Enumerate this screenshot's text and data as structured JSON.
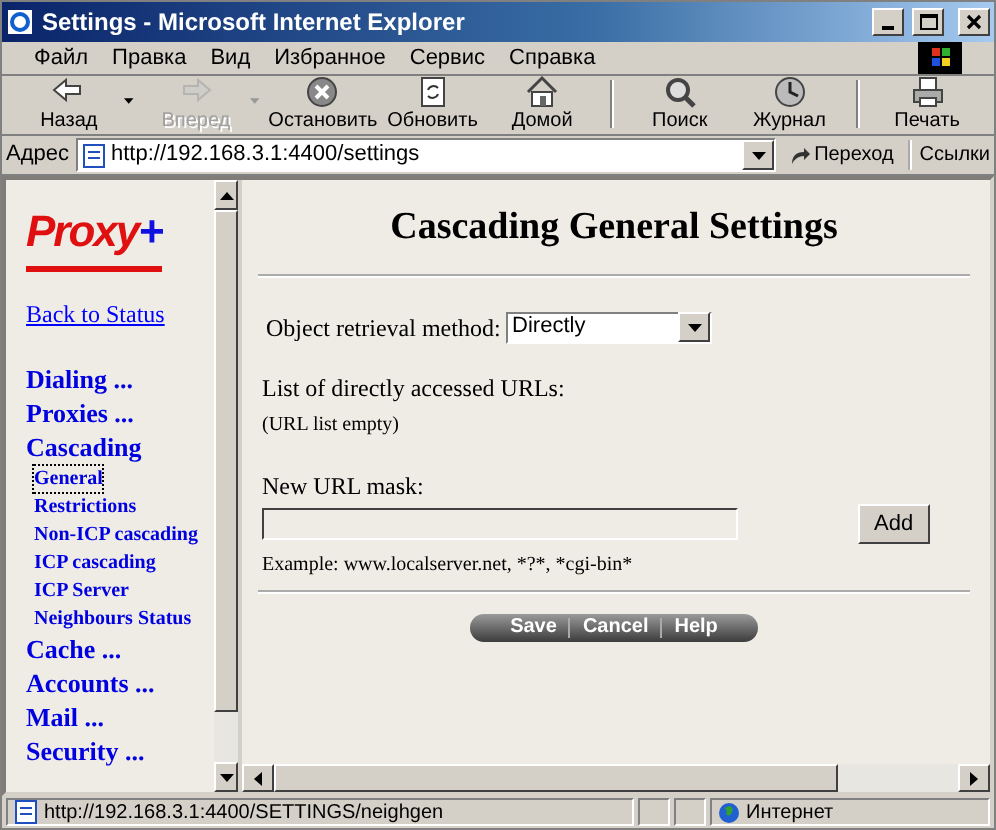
{
  "window": {
    "title": "Settings - Microsoft Internet Explorer"
  },
  "menu": [
    "Файл",
    "Правка",
    "Вид",
    "Избранное",
    "Сервис",
    "Справка"
  ],
  "toolbar": [
    {
      "kind": "back",
      "label": "Назад",
      "disabled": false,
      "dropdown": true
    },
    {
      "kind": "forward",
      "label": "Вперед",
      "disabled": true,
      "dropdown": true
    },
    {
      "kind": "stop",
      "label": "Остановить",
      "disabled": false,
      "dropdown": false
    },
    {
      "kind": "refresh",
      "label": "Обновить",
      "disabled": false,
      "dropdown": false
    },
    {
      "kind": "home",
      "label": "Домой",
      "disabled": false,
      "dropdown": false
    },
    {
      "kind": "search",
      "label": "Поиск",
      "disabled": false,
      "dropdown": false
    },
    {
      "kind": "history",
      "label": "Журнал",
      "disabled": false,
      "dropdown": false
    },
    {
      "kind": "print",
      "label": "Печать",
      "disabled": false,
      "dropdown": false
    }
  ],
  "address_bar": {
    "label": "Адрес",
    "url": "http://192.168.3.1:4400/settings",
    "go": "Переход",
    "links": "Ссылки"
  },
  "sidebar": {
    "logo": "Proxy",
    "logo_mark": "+",
    "back_link": "Back to Status",
    "items": [
      {
        "label": "Dialing ..."
      },
      {
        "label": "Proxies ..."
      },
      {
        "label": "Cascading",
        "children": [
          {
            "label": "General",
            "selected": true
          },
          {
            "label": "Restrictions",
            "selected": false
          },
          {
            "label": "Non-ICP cascading",
            "selected": false
          },
          {
            "label": "ICP cascading",
            "selected": false
          },
          {
            "label": "ICP Server",
            "selected": false
          },
          {
            "label": "Neighbours Status",
            "selected": false
          }
        ]
      },
      {
        "label": "Cache ..."
      },
      {
        "label": "Accounts ..."
      },
      {
        "label": "Mail ..."
      },
      {
        "label": "Security ..."
      }
    ]
  },
  "main": {
    "title": "Cascading General Settings",
    "retrieval_label": "Object retrieval method:",
    "retrieval_value": "Directly",
    "list_label": "List of directly accessed URLs:",
    "list_empty": "(URL list empty)",
    "mask_label": "New URL mask:",
    "add_button": "Add",
    "example": "Example: www.localserver.net, *?*, *cgi-bin*",
    "actions": [
      "Save",
      "Cancel",
      "Help"
    ]
  },
  "status_bar": {
    "url": "http://192.168.3.1:4400/SETTINGS/neighgen",
    "zone": "Интернет"
  }
}
